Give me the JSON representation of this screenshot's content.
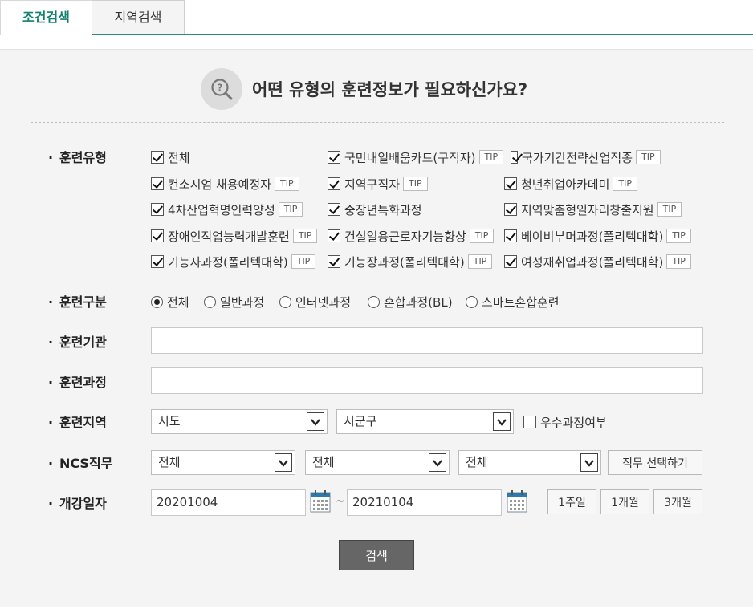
{
  "tabs": [
    {
      "label": "조건검색"
    },
    {
      "label": "지역검색"
    }
  ],
  "heading": "어떤 유형의 훈련정보가 필요하신가요?",
  "training_type": {
    "label": "훈련유형",
    "items": [
      {
        "label": "전체",
        "tip": ""
      },
      {
        "label": "국민내일배움카드(구직자)",
        "tip": "TIP"
      },
      {
        "label": "국가기간전략산업직종",
        "tip": "TIP"
      },
      {
        "label": "컨소시엄 채용예정자",
        "tip": "TIP"
      },
      {
        "label": "지역구직자",
        "tip": "TIP"
      },
      {
        "label": "청년취업아카데미",
        "tip": "TIP"
      },
      {
        "label": "4차산업혁명인력양성",
        "tip": "TIP"
      },
      {
        "label": "중장년특화과정",
        "tip": ""
      },
      {
        "label": "지역맞춤형일자리창출지원",
        "tip": "TIP"
      },
      {
        "label": "장애인직업능력개발훈련",
        "tip": "TIP"
      },
      {
        "label": "건설일용근로자기능향상",
        "tip": "TIP"
      },
      {
        "label": "베이비부머과정(폴리텍대학)",
        "tip": "TIP"
      },
      {
        "label": "기능사과정(폴리텍대학)",
        "tip": "TIP"
      },
      {
        "label": "기능장과정(폴리텍대학)",
        "tip": "TIP"
      },
      {
        "label": "여성재취업과정(폴리텍대학)",
        "tip": "TIP"
      }
    ]
  },
  "training_category": {
    "label": "훈련구분",
    "options": [
      "전체",
      "일반과정",
      "인터넷과정",
      "혼합과정(BL)",
      "스마트혼합훈련"
    ],
    "selected": "전체"
  },
  "institution": {
    "label": "훈련기관",
    "value": ""
  },
  "course": {
    "label": "훈련과정",
    "value": ""
  },
  "region": {
    "label": "훈련지역",
    "sido": "시도",
    "sigungu": "시군구",
    "excellent_label": "우수과정여부"
  },
  "ncs": {
    "label": "NCS직무",
    "sel1": "전체",
    "sel2": "전체",
    "sel3": "전체",
    "button": "직무 선택하기"
  },
  "open_date": {
    "label": "개강일자",
    "start": "20201004",
    "separator": "~",
    "end": "20210104",
    "buttons": [
      "1주일",
      "1개월",
      "3개월"
    ]
  },
  "search_button": "검색"
}
